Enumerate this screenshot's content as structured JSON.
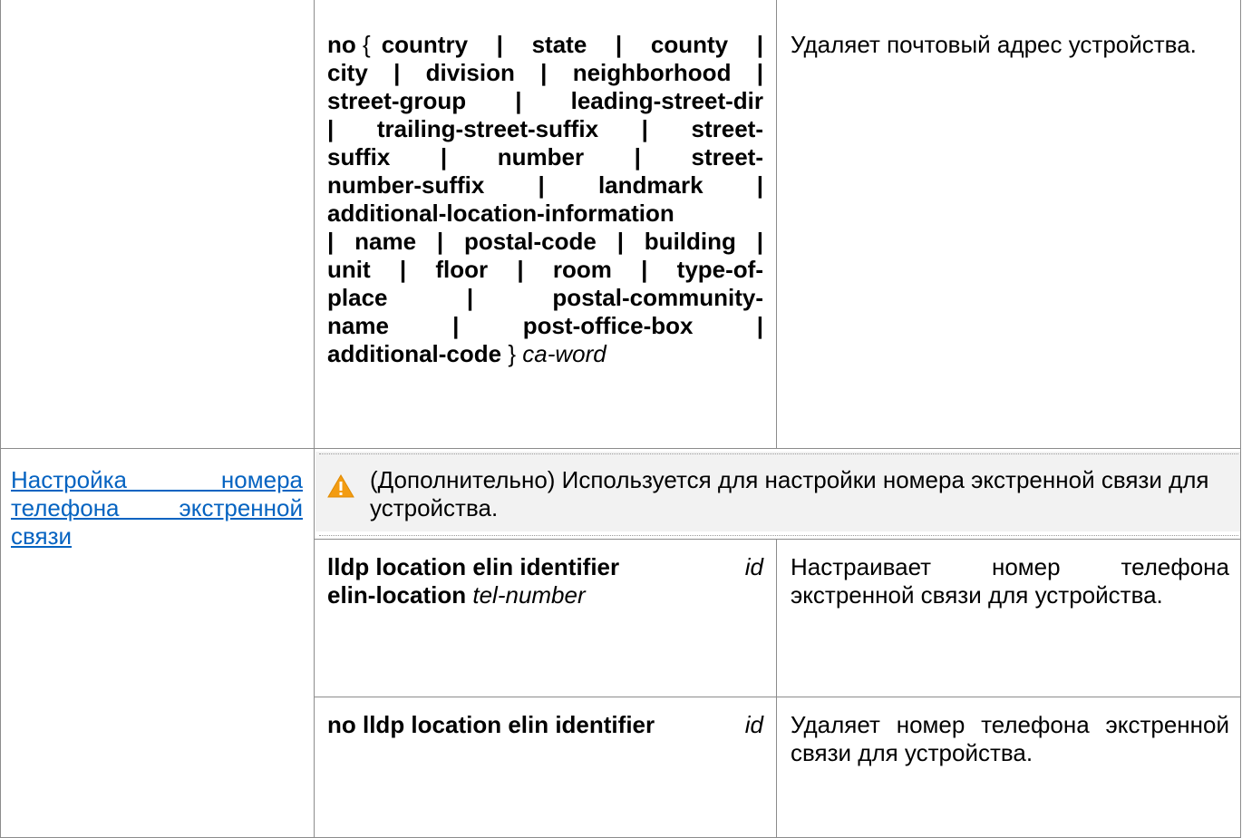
{
  "table": {
    "row1": {
      "command": {
        "kw_no": "no",
        "brace_open": "{",
        "options_line1": "country | state | county |",
        "options_line2": "city | division | neighborhood |",
        "options_line3": "street-group | leading-street-dir",
        "options_line4": "| trailing-street-suffix | street-",
        "options_line5": "suffix | number | street-",
        "options_line6": "number-suffix | landmark |",
        "options_line7": "additional-location-information",
        "options_line8": "| name | postal-code | building |",
        "options_line9": "unit | floor | room | type-of-",
        "options_line10": "place | postal-community-",
        "options_line11": "name | post-office-box |",
        "last_kw": "additional-code",
        "brace_close": "}",
        "arg": "ca-word"
      },
      "description": "Удаляет почтовый адрес устройства."
    },
    "row2": {
      "link_text": "Настройка номера телефона экстренной связи",
      "note": "(Дополнительно) Используется для настройки номера экстренной связи для устройства.",
      "cmd1": {
        "kw1": "lldp location elin identifier",
        "arg1": "id",
        "kw2": "elin-location",
        "arg2": "tel-number",
        "description": "Настраивает номер телефона экстренной связи для устройства."
      },
      "cmd2": {
        "kw": "no lldp location elin identifier",
        "arg": "id",
        "description": "Удаляет номер телефона экстренной связи для устройства."
      }
    }
  },
  "icons": {
    "warning": "warning-icon",
    "warning_fill": "#f39c12"
  },
  "colors": {
    "link": "#0563c1",
    "border": "#8c8c8c",
    "note_background": "#f2f2f2"
  }
}
